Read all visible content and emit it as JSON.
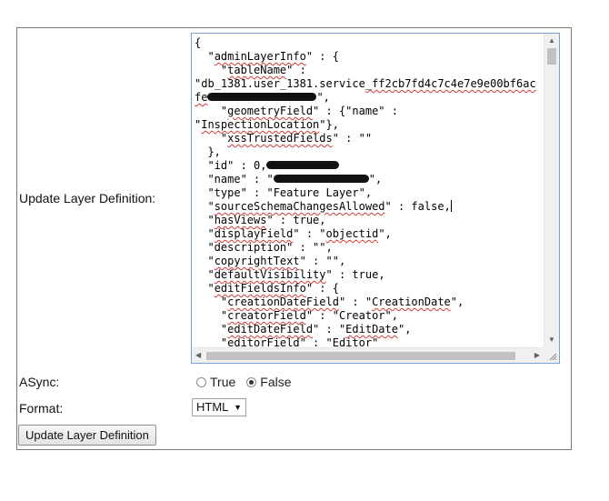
{
  "form": {
    "definition_label": "Update Layer Definition:",
    "async_label": "ASync:",
    "format_label": "Format:",
    "async_options": [
      {
        "label": "True",
        "selected": false
      },
      {
        "label": "False",
        "selected": true
      }
    ],
    "format_value": "HTML",
    "submit_label": "Update Layer Definition"
  },
  "code_lines": [
    [
      {
        "t": "{"
      }
    ],
    [
      {
        "t": "  \""
      },
      {
        "t": "adminLayerInfo",
        "sq": true
      },
      {
        "t": "\" : {"
      }
    ],
    [
      {
        "t": "    \""
      },
      {
        "t": "tableName",
        "sq": true
      },
      {
        "t": "\" :"
      }
    ],
    [
      {
        "t": "\"db_1381.user_1381.service"
      },
      {
        "t": "_ff2cb7fd4c7c4e7e9e00bf6ac",
        "sq": true
      }
    ],
    [
      {
        "t": "fe",
        "sq": true
      },
      {
        "redact": 120
      },
      {
        "t": "\","
      }
    ],
    [
      {
        "t": "    \""
      },
      {
        "t": "geometryField",
        "sq": true
      },
      {
        "t": "\" : {\"name\" :"
      }
    ],
    [
      {
        "t": "\""
      },
      {
        "t": "InspectionLocation",
        "sq": true
      },
      {
        "t": "\"},"
      }
    ],
    [
      {
        "t": "    \""
      },
      {
        "t": "xssTrustedFields",
        "sq": true
      },
      {
        "t": "\" : \"\""
      }
    ],
    [
      {
        "t": "  },"
      }
    ],
    [
      {
        "t": "  \"id\" : 0,"
      },
      {
        "redact": 80
      }
    ],
    [
      {
        "t": "  \"name\" : \""
      },
      {
        "redact": 105
      },
      {
        "t": "\","
      }
    ],
    [
      {
        "t": "  \"type\" : \"Feature Layer\","
      }
    ],
    [
      {
        "t": "  \""
      },
      {
        "t": "sourceSchemaChangesAllowed",
        "sq": true
      },
      {
        "t": "\" : false,"
      },
      {
        "caret": true
      }
    ],
    [
      {
        "t": "  \""
      },
      {
        "t": "hasViews",
        "sq": true
      },
      {
        "t": "\" : true,"
      }
    ],
    [
      {
        "t": "  \""
      },
      {
        "t": "displayField",
        "sq": true
      },
      {
        "t": "\" : \""
      },
      {
        "t": "objectid",
        "sq": true
      },
      {
        "t": "\","
      }
    ],
    [
      {
        "t": "  \"description\" : \"\","
      }
    ],
    [
      {
        "t": "  \""
      },
      {
        "t": "copyrightText",
        "sq": true
      },
      {
        "t": "\" : \"\","
      }
    ],
    [
      {
        "t": "  \""
      },
      {
        "t": "defaultVisibility",
        "sq": true
      },
      {
        "t": "\" : true,"
      }
    ],
    [
      {
        "t": "  \""
      },
      {
        "t": "editFieldsInfo",
        "sq": true
      },
      {
        "t": "\" : {"
      }
    ],
    [
      {
        "t": "    \""
      },
      {
        "t": "creationDateField",
        "sq": true
      },
      {
        "t": "\" : \""
      },
      {
        "t": "CreationDate",
        "sq": true
      },
      {
        "t": "\","
      }
    ],
    [
      {
        "t": "    \""
      },
      {
        "t": "creatorField",
        "sq": true
      },
      {
        "t": "\" : \"Creator\","
      }
    ],
    [
      {
        "t": "    \""
      },
      {
        "t": "editDateField",
        "sq": true
      },
      {
        "t": "\" : \""
      },
      {
        "t": "EditDate",
        "sq": true
      },
      {
        "t": "\","
      }
    ],
    [
      {
        "t": "    \""
      },
      {
        "t": "editorField",
        "sq": true
      },
      {
        "t": "\" : \"Editor\""
      }
    ]
  ]
}
